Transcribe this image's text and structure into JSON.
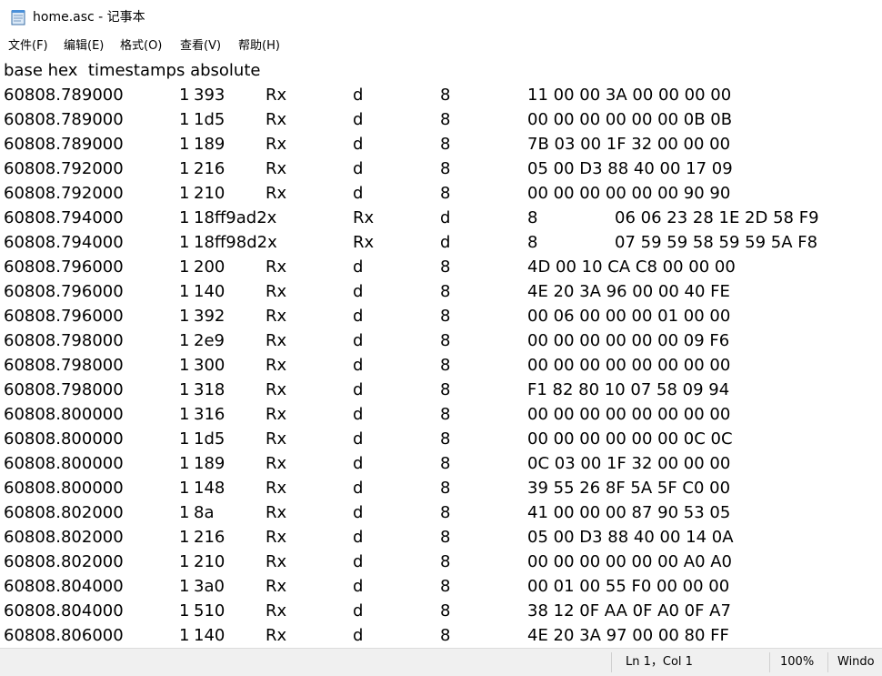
{
  "window": {
    "title": "home.asc - 记事本"
  },
  "menu": [
    {
      "label": "文件(F)"
    },
    {
      "label": "编辑(E)"
    },
    {
      "label": "格式(O)"
    },
    {
      "label": "查看(V)"
    },
    {
      "label": "帮助(H)"
    }
  ],
  "editor": {
    "header": "base hex  timestamps absolute",
    "rows": [
      {
        "time": "60808.789000",
        "ch": "1",
        "id": "393",
        "dir": "Rx",
        "type": "d",
        "dlc": "8",
        "data": "11 00 00 3A 00 00 00 00"
      },
      {
        "time": "60808.789000",
        "ch": "1",
        "id": "1d5",
        "dir": "Rx",
        "type": "d",
        "dlc": "8",
        "data": "00 00 00 00 00 00 0B 0B"
      },
      {
        "time": "60808.789000",
        "ch": "1",
        "id": "189",
        "dir": "Rx",
        "type": "d",
        "dlc": "8",
        "data": "7B 03 00 1F 32 00 00 00"
      },
      {
        "time": "60808.792000",
        "ch": "1",
        "id": "216",
        "dir": "Rx",
        "type": "d",
        "dlc": "8",
        "data": "05 00 D3 88 40 00 17 09"
      },
      {
        "time": "60808.792000",
        "ch": "1",
        "id": "210",
        "dir": "Rx",
        "type": "d",
        "dlc": "8",
        "data": "00 00 00 00 00 00 90 90"
      },
      {
        "time": "60808.794000",
        "ch": "1",
        "id": "18ff9ad2x",
        "dir": "Rx",
        "type": "d",
        "dlc": "8",
        "data": "06 06 23 28 1E 2D 58 F9",
        "ext": true
      },
      {
        "time": "60808.794000",
        "ch": "1",
        "id": "18ff98d2x",
        "dir": "Rx",
        "type": "d",
        "dlc": "8",
        "data": "07 59 59 58 59 59 5A F8",
        "ext": true
      },
      {
        "time": "60808.796000",
        "ch": "1",
        "id": "200",
        "dir": "Rx",
        "type": "d",
        "dlc": "8",
        "data": "4D 00 10 CA C8 00 00 00"
      },
      {
        "time": "60808.796000",
        "ch": "1",
        "id": "140",
        "dir": "Rx",
        "type": "d",
        "dlc": "8",
        "data": "4E 20 3A 96 00 00 40 FE"
      },
      {
        "time": "60808.796000",
        "ch": "1",
        "id": "392",
        "dir": "Rx",
        "type": "d",
        "dlc": "8",
        "data": "00 06 00 00 00 01 00 00"
      },
      {
        "time": "60808.798000",
        "ch": "1",
        "id": "2e9",
        "dir": "Rx",
        "type": "d",
        "dlc": "8",
        "data": "00 00 00 00 00 00 09 F6"
      },
      {
        "time": "60808.798000",
        "ch": "1",
        "id": "300",
        "dir": "Rx",
        "type": "d",
        "dlc": "8",
        "data": "00 00 00 00 00 00 00 00"
      },
      {
        "time": "60808.798000",
        "ch": "1",
        "id": "318",
        "dir": "Rx",
        "type": "d",
        "dlc": "8",
        "data": "F1 82 80 10 07 58 09 94"
      },
      {
        "time": "60808.800000",
        "ch": "1",
        "id": "316",
        "dir": "Rx",
        "type": "d",
        "dlc": "8",
        "data": "00 00 00 00 00 00 00 00"
      },
      {
        "time": "60808.800000",
        "ch": "1",
        "id": "1d5",
        "dir": "Rx",
        "type": "d",
        "dlc": "8",
        "data": "00 00 00 00 00 00 0C 0C"
      },
      {
        "time": "60808.800000",
        "ch": "1",
        "id": "189",
        "dir": "Rx",
        "type": "d",
        "dlc": "8",
        "data": "0C 03 00 1F 32 00 00 00"
      },
      {
        "time": "60808.800000",
        "ch": "1",
        "id": "148",
        "dir": "Rx",
        "type": "d",
        "dlc": "8",
        "data": "39 55 26 8F 5A 5F C0 00"
      },
      {
        "time": "60808.802000",
        "ch": "1",
        "id": "8a",
        "dir": "Rx",
        "type": "d",
        "dlc": "8",
        "data": "41 00 00 00 87 90 53 05"
      },
      {
        "time": "60808.802000",
        "ch": "1",
        "id": "216",
        "dir": "Rx",
        "type": "d",
        "dlc": "8",
        "data": "05 00 D3 88 40 00 14 0A"
      },
      {
        "time": "60808.802000",
        "ch": "1",
        "id": "210",
        "dir": "Rx",
        "type": "d",
        "dlc": "8",
        "data": "00 00 00 00 00 00 A0 A0"
      },
      {
        "time": "60808.804000",
        "ch": "1",
        "id": "3a0",
        "dir": "Rx",
        "type": "d",
        "dlc": "8",
        "data": "00 01 00 55 F0 00 00 00"
      },
      {
        "time": "60808.804000",
        "ch": "1",
        "id": "510",
        "dir": "Rx",
        "type": "d",
        "dlc": "8",
        "data": "38 12 0F AA 0F A0 0F A7"
      },
      {
        "time": "60808.806000",
        "ch": "1",
        "id": "140",
        "dir": "Rx",
        "type": "d",
        "dlc": "8",
        "data": "4E 20 3A 97 00 00 80 FF"
      }
    ]
  },
  "statusbar": {
    "position": "Ln 1，Col 1",
    "zoom": "100%",
    "lineending": "Windo"
  }
}
